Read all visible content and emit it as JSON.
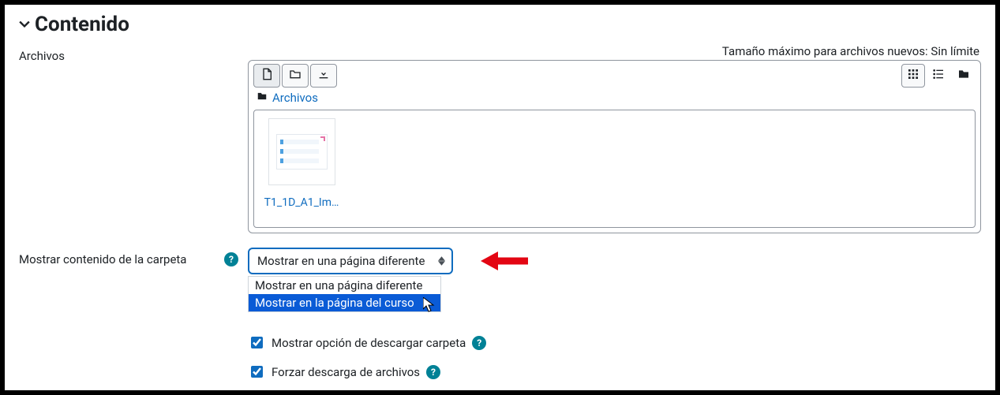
{
  "section": {
    "title": "Contenido"
  },
  "files": {
    "label": "Archivos",
    "maxsize": "Tamaño máximo para archivos nuevos: Sin límite",
    "breadcrumb": "Archivos",
    "items": [
      {
        "name": "T1_1D_A1_Im…"
      }
    ]
  },
  "display": {
    "label": "Mostrar contenido de la carpeta",
    "selected": "Mostrar en una página diferente",
    "options": [
      "Mostrar en una página diferente",
      "Mostrar en la página del curso"
    ]
  },
  "checkboxes": {
    "download": {
      "label": "Mostrar opción de descargar carpeta",
      "checked": true
    },
    "force": {
      "label": "Forzar descarga de archivos",
      "checked": true
    }
  }
}
